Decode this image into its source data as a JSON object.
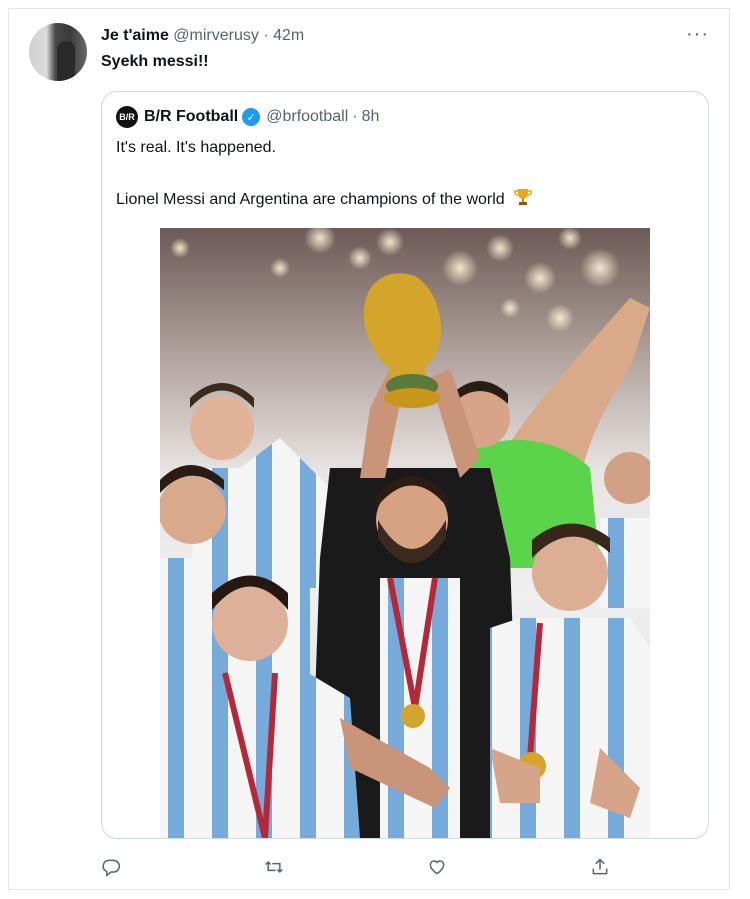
{
  "tweet": {
    "display_name": "Je t'aime",
    "handle": "@mirverusy",
    "separator": "·",
    "time": "42m",
    "text": "Syekh messi!!"
  },
  "quoted": {
    "display_name": "B/R Football",
    "logo_text": "B/R",
    "handle": "@brfootball",
    "separator": "·",
    "time": "8h",
    "line1": "It's real. It's happened.",
    "line2": "Lionel Messi and Argentina are champions of the world"
  },
  "icons": {
    "more": "more-icon",
    "verified": "verified-badge-icon",
    "trophy": "trophy-icon",
    "reply": "reply-icon",
    "retweet": "retweet-icon",
    "like": "like-icon",
    "share": "share-icon"
  },
  "colors": {
    "text": "#0f1419",
    "muted": "#536471",
    "verified_blue": "#1d9bf0",
    "border": "#cfd9de",
    "jersey_blue": "#75aadb"
  }
}
